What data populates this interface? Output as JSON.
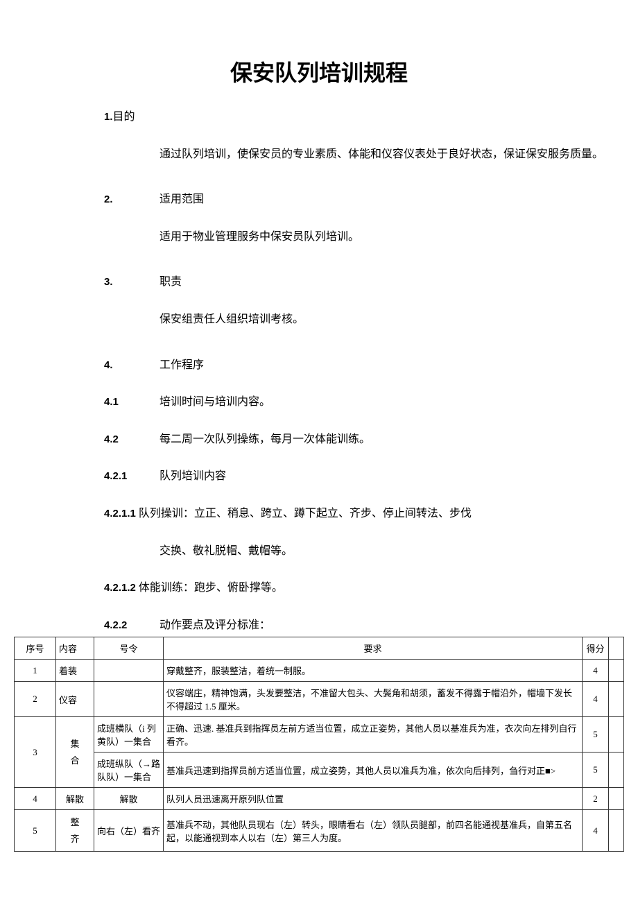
{
  "title": "保安队列培训规程",
  "sections": {
    "s1": {
      "num": "1.",
      "label": "目的",
      "body": "通过队列培训，使保安员的专业素质、体能和仪容仪表处于良好状态，保证保安服务质量。"
    },
    "s2": {
      "num": "2.",
      "label": "适用范围",
      "body": "适用于物业管理服务中保安员队列培训。"
    },
    "s3": {
      "num": "3.",
      "label": "职责",
      "body": "保安组责任人组织培训考核。"
    },
    "s4": {
      "num": "4.",
      "label": "工作程序"
    },
    "s41": {
      "num": "4.1",
      "body": "培训时间与培训内容。"
    },
    "s42": {
      "num": "4.2",
      "body": "每二周一次队列操练，每月一次体能训练。"
    },
    "s421": {
      "num": "4.2.1",
      "body": "队列培训内容"
    },
    "s4211a": {
      "num": "4.2.1.1",
      "body": "队列操训：立正、稍息、跨立、蹲下起立、齐步、停止间转法、步伐"
    },
    "s4211b": "交换、敬礼脱帽、戴帽等。",
    "s4212": {
      "num": "4.2.1.2",
      "body": "体能训练：跑步、俯卧撑等。"
    },
    "s422": {
      "num": "4.2.2",
      "body": "动作要点及评分标准："
    }
  },
  "table": {
    "headers": {
      "seq": "序号",
      "content": "内容",
      "cmd": "号令",
      "req": "要求",
      "score": "得分"
    },
    "rows": [
      {
        "seq": "1",
        "content": "着装",
        "cmd": "",
        "req": "穿戴整齐，服装整洁，着统一制服。",
        "score": "4"
      },
      {
        "seq": "2",
        "content": "仪容",
        "cmd": "",
        "req": "仪容端庄，精神饱满，头发要整洁，不准留大包头、大鬓角和胡须，蓄发不得露于帽沿外，帽墙下发长不得超过 1.5 厘米。",
        "score": "4"
      }
    ],
    "row3": {
      "seq": "3",
      "content": "集合",
      "sub1": {
        "cmd": "成班横队（i 列黄队）一集合",
        "req": "正确、迅速. 基准兵到指挥员左前方适当位置，成立正姿势，其他人员以基准兵为准，衣次向左排列自行看齐。",
        "score": "5"
      },
      "sub2": {
        "cmd": "成班纵队（→路队队）一集合",
        "req": "基准兵迅速到指挥员前方适当位置，成立姿势，其他人员以准兵为准，依次向后排列，刍行对正■>",
        "score": "5"
      }
    },
    "row4": {
      "seq": "4",
      "content": "解散",
      "cmd": "解散",
      "req": "队列人员迅速离开原列队位置",
      "score": "2"
    },
    "row5": {
      "seq": "5",
      "content": "整齐",
      "cmd": "向右（左）看齐",
      "req": "基准兵不动，其他队员现右（左）转头，眼睛看右（左）领队员腿部，前四名能通视基准兵，自第五名起，以能通视到本人以右（左）第三人为度。",
      "score": "4"
    }
  }
}
